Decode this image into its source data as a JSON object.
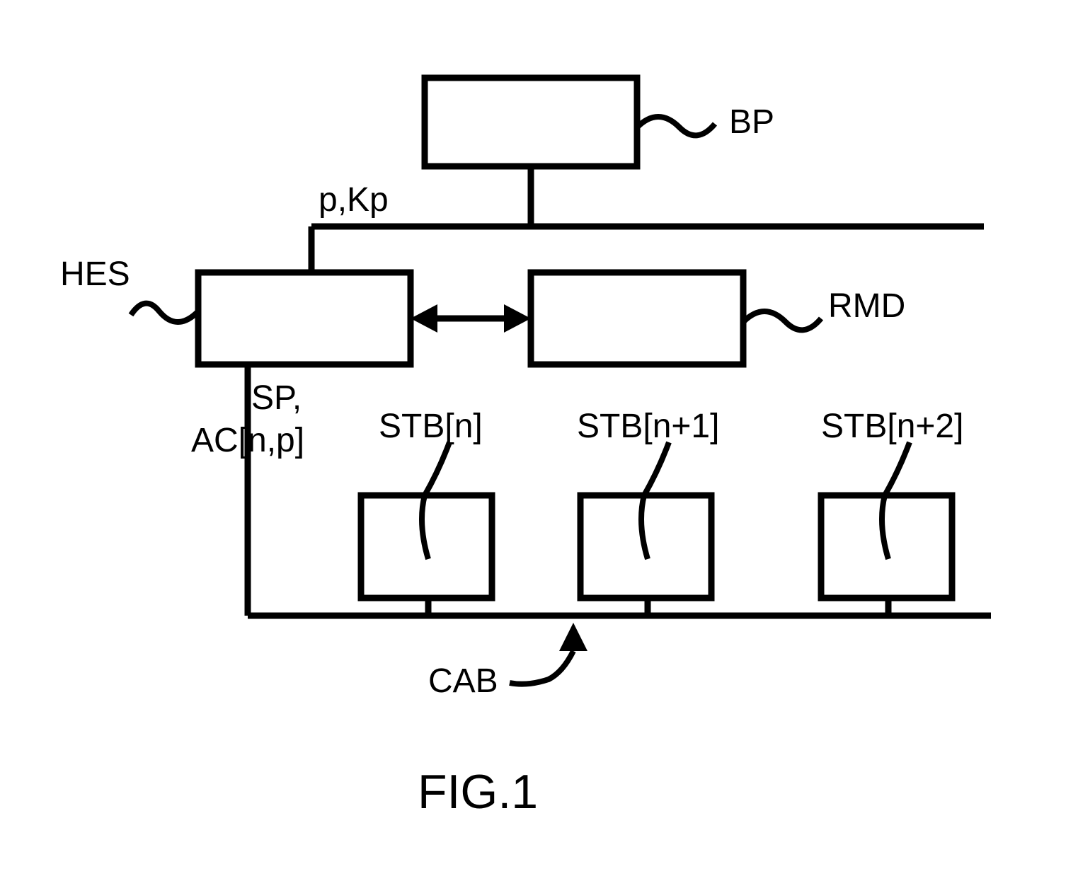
{
  "labels": {
    "bp": "BP",
    "hes": "HES",
    "rmd": "RMD",
    "pkp": "p,Kp",
    "sp": "SP,",
    "acnp": "AC[n,p]",
    "stbn": "STB[n]",
    "stbn1": "STB[n+1]",
    "stbn2": "STB[n+2]",
    "cab": "CAB",
    "figure": "FIG.1"
  }
}
